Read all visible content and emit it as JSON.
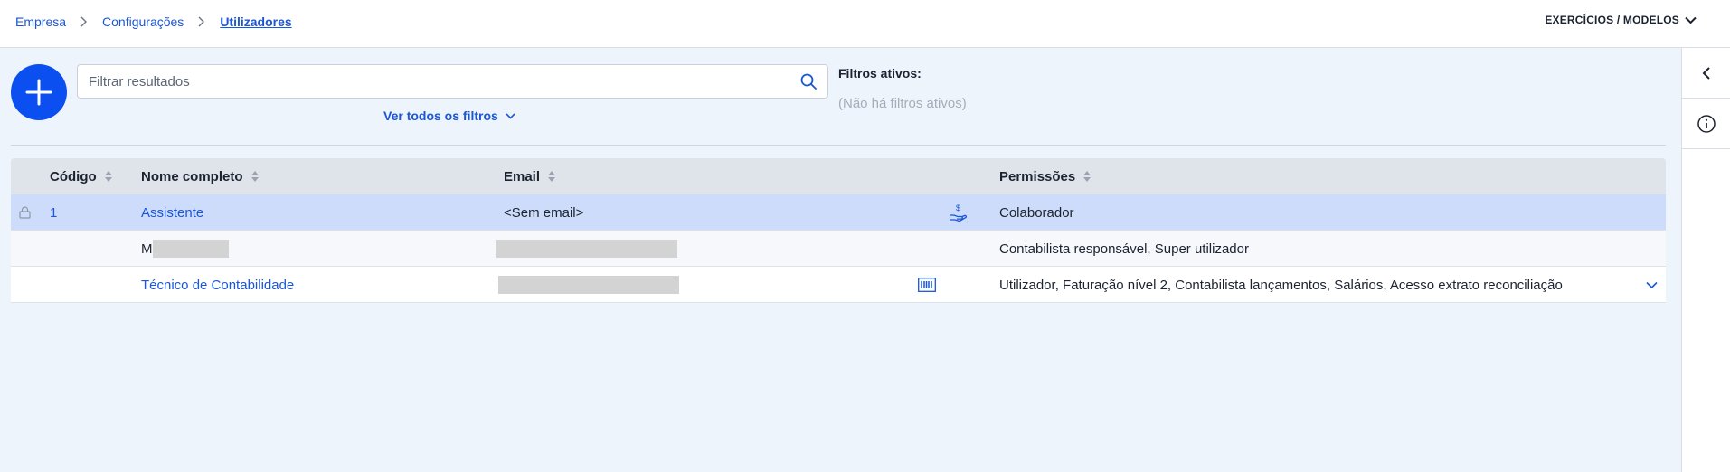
{
  "breadcrumb": {
    "items": [
      "Empresa",
      "Configurações",
      "Utilizadores"
    ]
  },
  "header": {
    "exercicios_label": "EXERCÍCIOS / MODELOS"
  },
  "search": {
    "placeholder": "Filtrar resultados"
  },
  "filters": {
    "see_all_label": "Ver todos os filtros",
    "active_title": "Filtros ativos:",
    "active_empty": "(Não há filtros ativos)"
  },
  "table": {
    "columns": [
      "Código",
      "Nome completo",
      "Email",
      "Permissões"
    ],
    "rows": [
      {
        "code": "1",
        "name": "Assistente",
        "email": "<Sem email>",
        "permissions": "Colaborador",
        "locked": true,
        "icon": "hand-coin-icon"
      },
      {
        "code": "",
        "name": "M",
        "email": "",
        "permissions": "Contabilista responsável, Super utilizador"
      },
      {
        "code": "",
        "name": "Técnico de Contabilidade",
        "email": "",
        "permissions": "Utilizador, Faturação nível 2, Contabilista lançamentos, Salários, Acesso extrato reconciliação",
        "icon": "barcode-icon"
      }
    ]
  },
  "colors": {
    "accent": "#0b4ff0",
    "link": "#1a56d6",
    "selected_row": "#cddcfb",
    "background": "#eef4fc"
  }
}
